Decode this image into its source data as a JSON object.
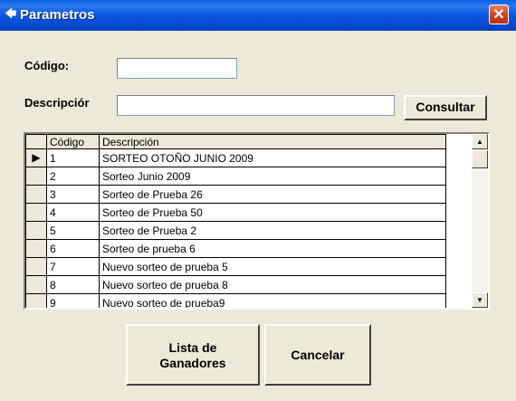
{
  "window": {
    "title": "Parametros",
    "close_label": "✕"
  },
  "form": {
    "codigo_label": "Código:",
    "codigo_value": "",
    "descripcion_label": "Descripciór",
    "descripcion_value": "",
    "consultar_label": "Consultar"
  },
  "grid": {
    "columns": [
      "Código",
      "Descripción"
    ],
    "selected_row": 0,
    "rows": [
      {
        "codigo": "1",
        "descripcion": "SORTEO OTOÑO JUNIO 2009"
      },
      {
        "codigo": "2",
        "descripcion": "Sorteo Junio 2009"
      },
      {
        "codigo": "3",
        "descripcion": "Sorteo de Prueba 26"
      },
      {
        "codigo": "4",
        "descripcion": "Sorteo de Prueba 50"
      },
      {
        "codigo": "5",
        "descripcion": "Sorteo de Prueba 2"
      },
      {
        "codigo": "6",
        "descripcion": "Sorteo de prueba 6"
      },
      {
        "codigo": "7",
        "descripcion": "Nuevo sorteo de prueba 5"
      },
      {
        "codigo": "8",
        "descripcion": "Nuevo sorteo de prueba 8"
      },
      {
        "codigo": "9",
        "descripcion": "Nuevo sorteo de prueba9"
      }
    ],
    "current_row_marker": "▶"
  },
  "buttons": {
    "lista_line1": "Lista de",
    "lista_line2": "Ganadores",
    "cancelar": "Cancelar"
  }
}
